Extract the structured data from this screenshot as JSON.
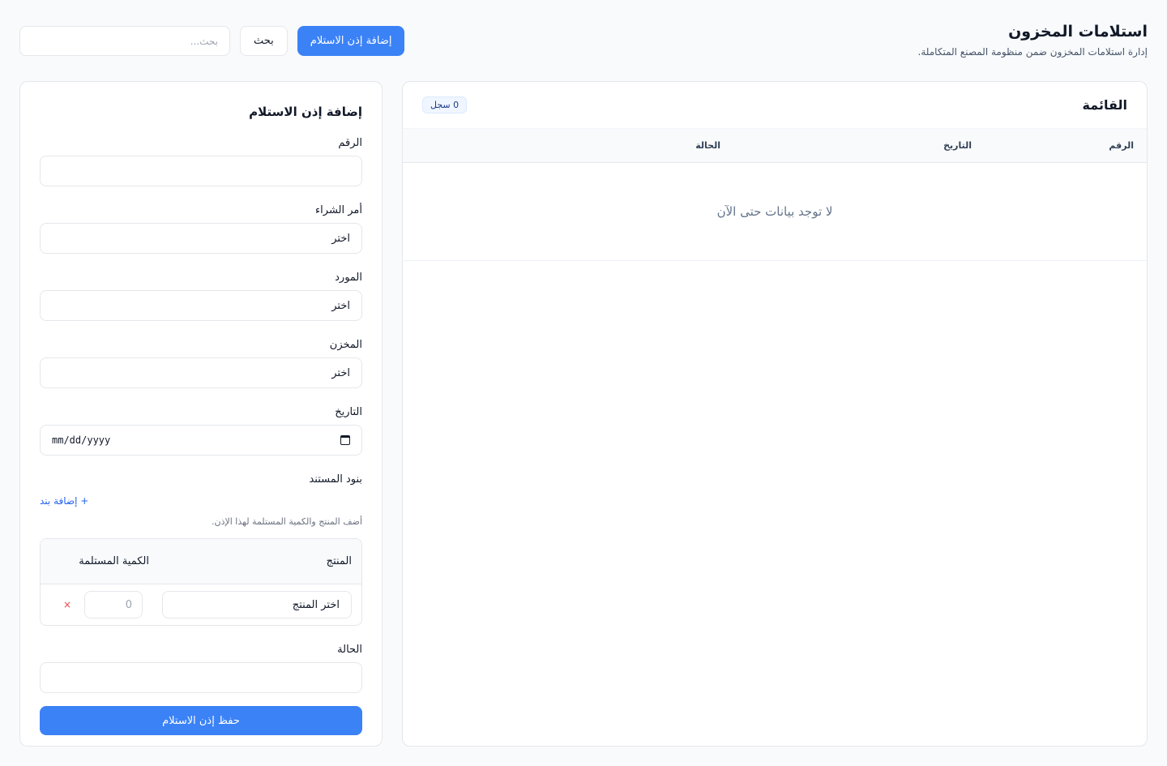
{
  "header": {
    "title": "استلامات المخزون",
    "subtitle": "إدارة استلامات المخزون ضمن منظومة المصنع المتكاملة.",
    "search_placeholder": "بحث...",
    "search_button": "بحث",
    "add_button": "إضافة إذن الاستلام"
  },
  "list": {
    "title": "القائمة",
    "count_badge": "0 سجل",
    "columns": [
      "الرقم",
      "التاريخ",
      "الحالة"
    ],
    "empty_message": "لا توجد بيانات حتى الآن"
  },
  "form": {
    "title": "إضافة إذن الاستلام",
    "number_label": "الرقم",
    "number_value": "",
    "purchase_order_label": "أمر الشراء",
    "purchase_order_value": "اختر",
    "supplier_label": "المورد",
    "supplier_value": "اختر",
    "warehouse_label": "المخزن",
    "warehouse_value": "اختر",
    "date_label": "التاريخ",
    "date_value": "mm/dd/yyyy",
    "items_label": "بنود المستند",
    "add_item": "+ إضافة بند",
    "items_hint": "أضف المنتج والكمية المستلمة لهذا الإذن.",
    "items_columns": {
      "product": "المنتج",
      "qty": "الكمية المستلمة"
    },
    "items": [
      {
        "product": "اختر المنتج",
        "qty": "0",
        "remove": "×"
      }
    ],
    "status_label": "الحالة",
    "status_value": "",
    "save_button": "حفظ إذن الاستلام"
  }
}
